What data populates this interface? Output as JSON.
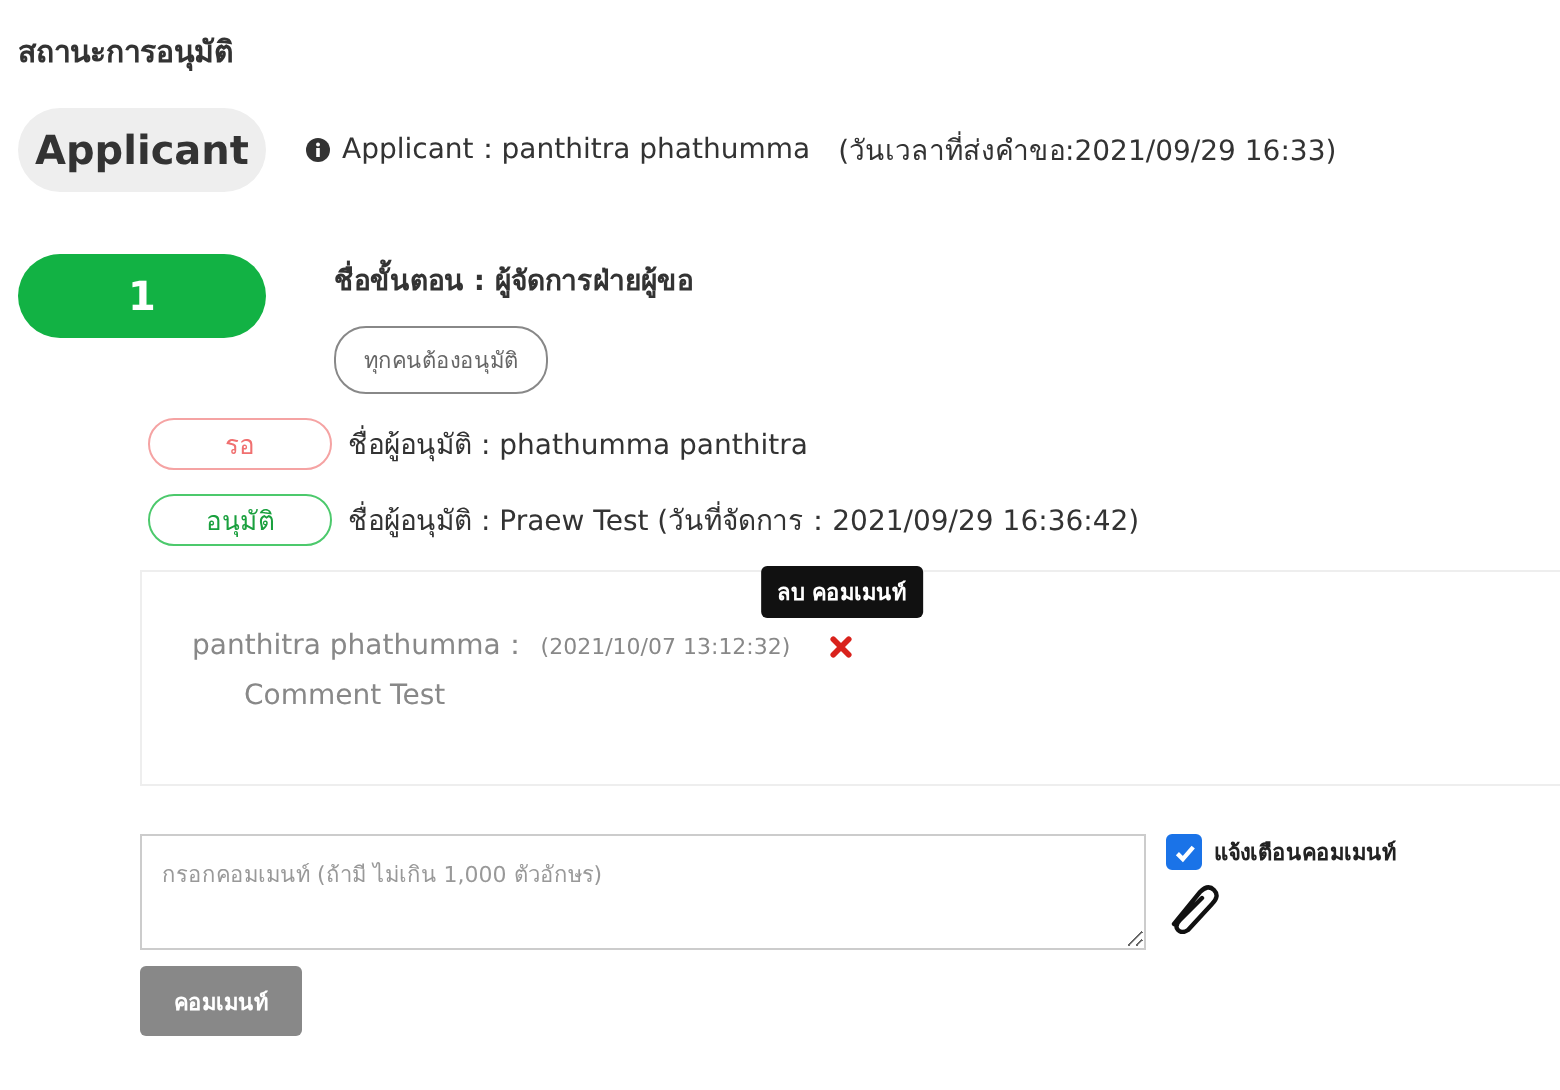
{
  "section_title": "สถานะการอนุมัติ",
  "applicant": {
    "badge": "Applicant",
    "info": "Applicant：panthitra phathumma",
    "submitted": "(วันเวลาที่ส่งคำขอ:2021/09/29 16:33)"
  },
  "step": {
    "number": "1",
    "name": "ชื่อขั้นตอน : ผู้จัดการฝ่ายผู้ขอ",
    "rule": "ทุกคนต้องอนุมัติ"
  },
  "approvers": [
    {
      "status": "รอ",
      "kind": "waiting",
      "text": "ชื่อผู้อนุมัติ : phathumma panthitra"
    },
    {
      "status": "อนุมัติ",
      "kind": "approved",
      "text": "ชื่อผู้อนุมัติ : Praew Test (วันที่จัดการ：2021/09/29 16:36:42)"
    }
  ],
  "comments": [
    {
      "author": "panthitra phathumma：",
      "time": "(2021/10/07 13:12:32)",
      "text": "Comment Test",
      "tooltip": "ลบ คอมเมนท์"
    }
  ],
  "comment_field": {
    "placeholder": "กรอกคอมเมนท์ (ถ้ามี ไม่เกิน 1,000 ตัวอักษร)"
  },
  "notify": {
    "label": "แจ้งเตือนคอมเมนท์",
    "checked": true
  },
  "submit_button": "คอมเมนท์"
}
